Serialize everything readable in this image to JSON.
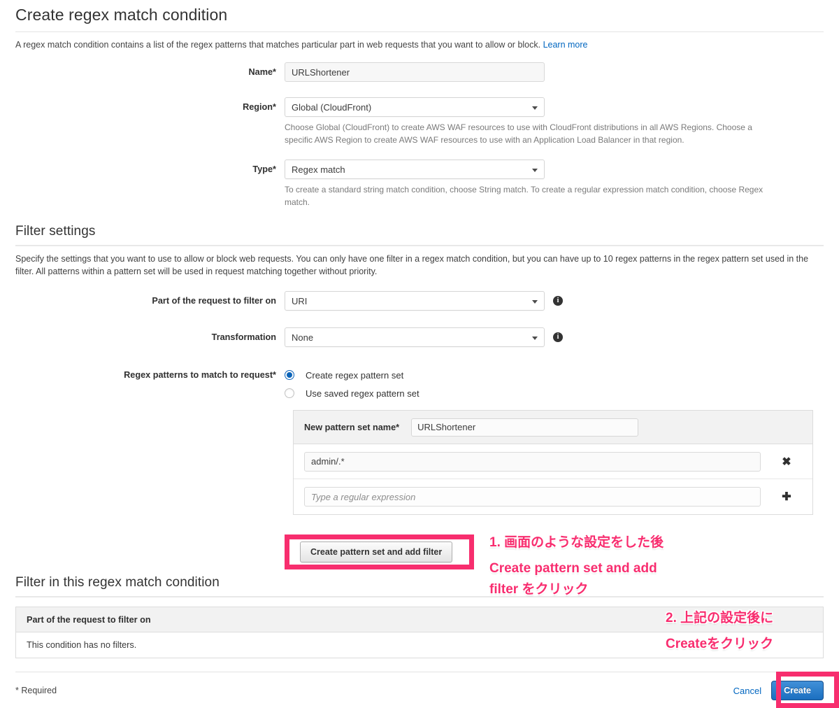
{
  "page": {
    "title": "Create regex match condition",
    "intro_text": "A regex match condition contains a list of the regex patterns that matches particular part in web requests that you want to allow or block.",
    "intro_link": "Learn more"
  },
  "form": {
    "name": {
      "label": "Name*",
      "value": "URLShortener"
    },
    "region": {
      "label": "Region*",
      "value": "Global (CloudFront)",
      "help": "Choose Global (CloudFront) to create AWS WAF resources to use with CloudFront distributions in all AWS Regions. Choose a specific AWS Region to create AWS WAF resources to use with an Application Load Balancer in that region."
    },
    "type": {
      "label": "Type*",
      "value": "Regex match",
      "help": "To create a standard string match condition, choose String match. To create a regular expression match condition, choose Regex match."
    }
  },
  "filter_settings": {
    "heading": "Filter settings",
    "description": "Specify the settings that you want to use to allow or block web requests. You can only have one filter in a regex match condition, but you can have up to 10 regex patterns in the regex pattern set used in the filter. All patterns within a pattern set will be used in request matching together without priority.",
    "part_of_request": {
      "label": "Part of the request to filter on",
      "value": "URI",
      "info_icon": "info-icon"
    },
    "transformation": {
      "label": "Transformation",
      "value": "None",
      "info_icon": "info-icon"
    },
    "regex_patterns": {
      "label": "Regex patterns to match to request*",
      "options": [
        {
          "label": "Create regex pattern set",
          "selected": true
        },
        {
          "label": "Use saved regex pattern set",
          "selected": false
        }
      ]
    }
  },
  "pattern_set": {
    "name_label": "New pattern set name*",
    "name_value": "URLShortener",
    "rows": [
      {
        "value": "admin/.*",
        "placeholder": "",
        "action_icon": "✖",
        "action_name": "remove-pattern-icon"
      },
      {
        "value": "",
        "placeholder": "Type a regular expression",
        "action_icon": "✚",
        "action_name": "add-pattern-icon"
      }
    ],
    "create_button": "Create pattern set and add filter"
  },
  "filter_table": {
    "heading": "Filter in this regex match condition",
    "column_header": "Part of the request to filter on",
    "empty_message": "This condition has no filters."
  },
  "footer": {
    "required_note": "* Required",
    "cancel": "Cancel",
    "create": "Create"
  },
  "annotations": {
    "accent_color": "#f82d6f",
    "note1_line1": "1. 画面のような設定をした後",
    "note1_line2": "Create pattern set and add",
    "note1_line3": "filter をクリック",
    "note2_line1": "2. 上記の設定後に",
    "note2_line2": "Createをクリック"
  }
}
